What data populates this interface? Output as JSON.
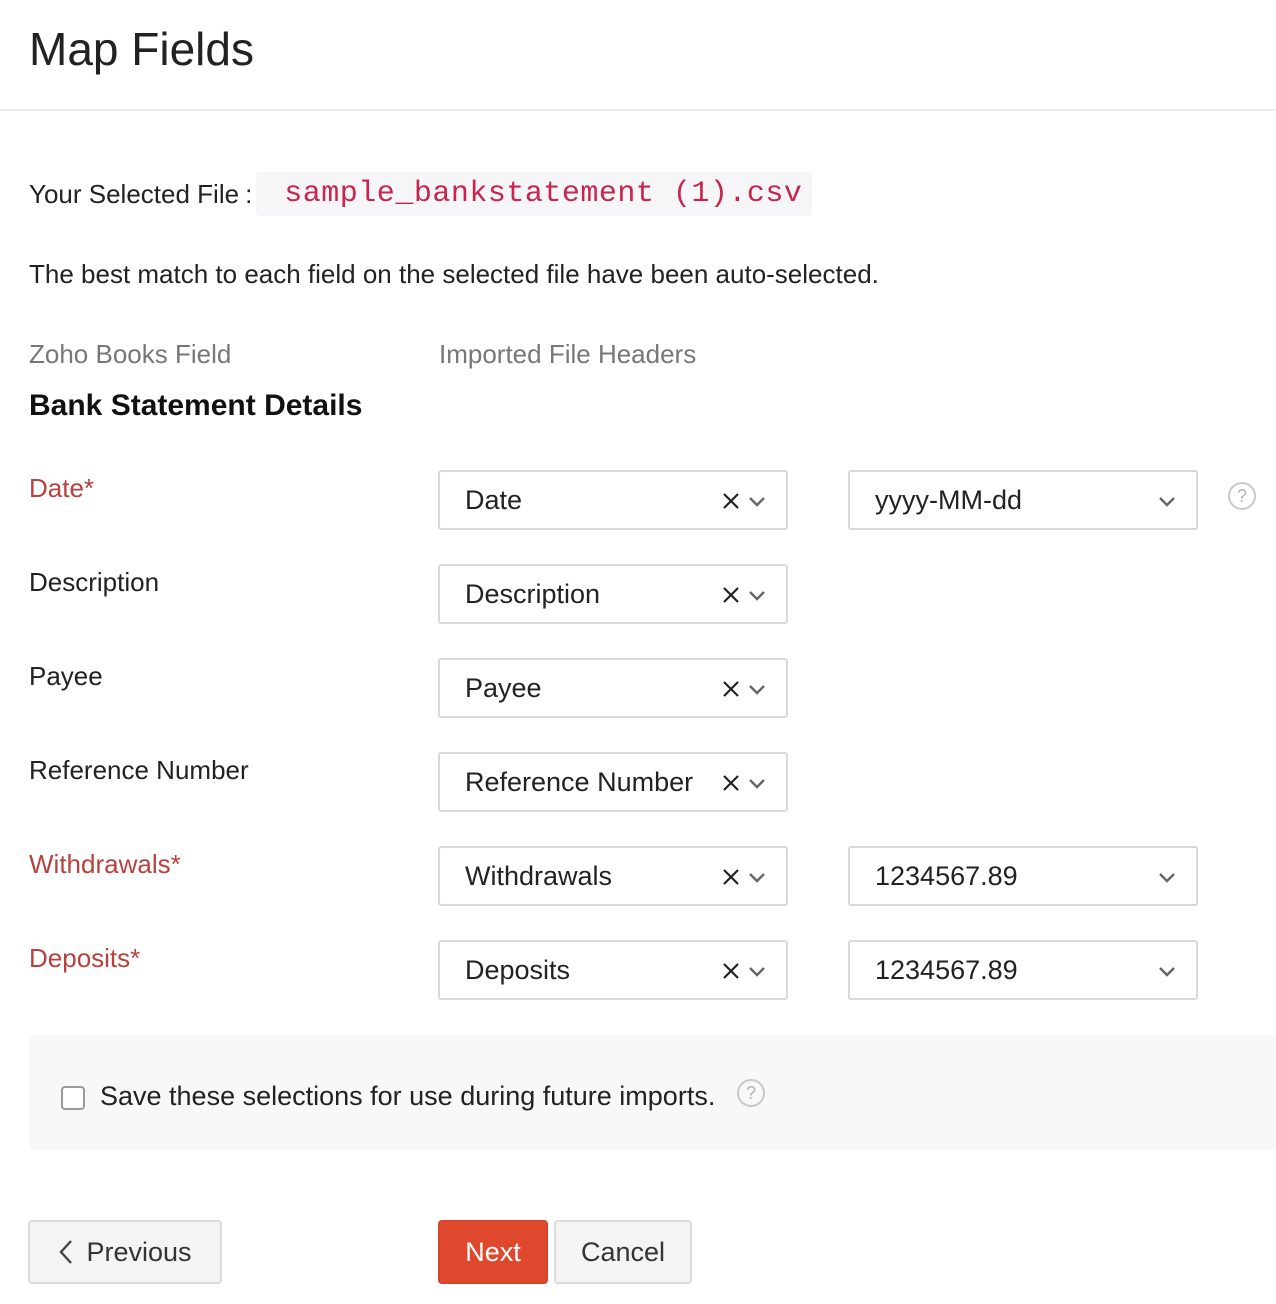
{
  "page": {
    "title": "Map Fields"
  },
  "file": {
    "label": "Your Selected File",
    "separator": ":",
    "name": "sample_bankstatement (1).csv"
  },
  "info": "The best match to each field on the selected file have been auto-selected.",
  "columns": {
    "left": "Zoho Books Field",
    "right": "Imported File Headers"
  },
  "section": {
    "title": "Bank Statement Details"
  },
  "fields": {
    "date": {
      "label": "Date*",
      "mapped": "Date",
      "format": "yyyy-MM-dd"
    },
    "description": {
      "label": "Description",
      "mapped": "Description"
    },
    "payee": {
      "label": "Payee",
      "mapped": "Payee"
    },
    "reference": {
      "label": "Reference Number",
      "mapped": "Reference Number"
    },
    "withdrawals": {
      "label": "Withdrawals*",
      "mapped": "Withdrawals",
      "format": "1234567.89"
    },
    "deposits": {
      "label": "Deposits*",
      "mapped": "Deposits",
      "format": "1234567.89"
    }
  },
  "help": {
    "glyph": "?"
  },
  "save": {
    "label": "Save these selections for use during future imports."
  },
  "buttons": {
    "previous": "Previous",
    "next": "Next",
    "cancel": "Cancel"
  },
  "colors": {
    "required": "#b8413d",
    "primary_button": "#e0482e",
    "file_name": "#c7254e"
  },
  "icons": {
    "clear": "close-icon",
    "dropdown": "chevron-down-icon",
    "back": "chevron-left-icon",
    "help": "help-circle-icon"
  }
}
